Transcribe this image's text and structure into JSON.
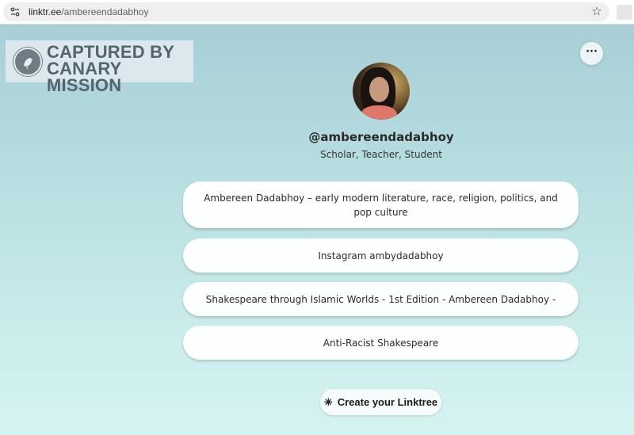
{
  "browser": {
    "url_domain": "linktr.ee",
    "url_path": "/ambereendadabhoy",
    "site_info_icon": "tune-icon",
    "star_icon": "star-outline-icon"
  },
  "watermark": {
    "line1": "CAPTURED BY",
    "line2": "CANARY MISSION"
  },
  "profile": {
    "more_label": "···",
    "handle": "@ambereendadabhoy",
    "bio": "Scholar, Teacher, Student"
  },
  "links": [
    {
      "label": "Ambereen Dadabhoy – early modern literature, race, religion, politics, and pop culture"
    },
    {
      "label": "Instagram ambydadabhoy"
    },
    {
      "label": "Shakespeare through Islamic Worlds - 1st Edition - Ambereen Dadabhoy -"
    },
    {
      "label": "Anti-Racist Shakespeare"
    }
  ],
  "footer": {
    "create_label": "Create your Linktree",
    "icon": "linktree-asterisk-icon"
  },
  "colors": {
    "page_top": "#a8cfd6",
    "page_bottom": "#d6f4f1",
    "button_bg": "#fdfefe",
    "watermark_text": "#55636b"
  }
}
